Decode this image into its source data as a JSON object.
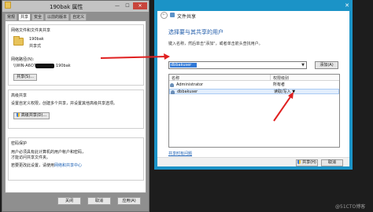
{
  "props": {
    "title": "190bak 属性",
    "min": "—",
    "max": "☐",
    "close": "✕",
    "tabs": [
      "常规",
      "共享",
      "安全",
      "以前的版本",
      "自定义"
    ],
    "share_group": {
      "title": "网络文件和文件夹共享",
      "folder_name": "190bak",
      "folder_status": "共享式",
      "path_label": "网络路径(N):",
      "path_prefix": "\\\\WIN-A6O7",
      "path_suffix": "190bak",
      "share_button": "共享(S)..."
    },
    "adv_group": {
      "title": "高级共享",
      "line1": "设置自定义权限，创建多个共享，并设置其他高级共享选项。",
      "button": "高级共享(D)..."
    },
    "pwd_group": {
      "title": "密码保护",
      "line1": "用户必须具有此计算机的用户帐户和密码，",
      "line2": "才能访问共享文件夹。",
      "line3_prefix": "若要更改此设置，请使用",
      "line3_link": "网络和共享中心"
    },
    "buttons": {
      "close": "关闭",
      "cancel": "取消",
      "apply": "应用(A)"
    }
  },
  "dialog": {
    "close": "✕",
    "back": "←",
    "title": "文件共享",
    "heading": "选择要与其共享的用户",
    "description": "键入名称，然后单击\"添加\"，或者单击箭头查找用户。",
    "combo_value": "dbbakuser",
    "combo_arrow": "▼",
    "add_button": "添加(A)",
    "columns": [
      "名称",
      "权限级别"
    ],
    "rows": [
      {
        "name": "Administrator",
        "permission": "所有者"
      },
      {
        "name": "dbbakuser",
        "permission": "读取/写入 ▼"
      }
    ],
    "trouble_link": "共享时有问题",
    "footer": {
      "share": "共享(H)",
      "cancel": "取消"
    }
  },
  "watermark": "@51CTO博客",
  "colors": {
    "dialog_border": "#1b93c7",
    "arrow": "#e02020",
    "link": "#1a5fb4"
  }
}
